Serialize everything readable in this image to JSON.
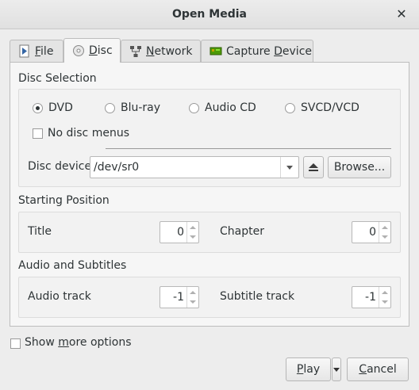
{
  "window": {
    "title": "Open Media",
    "close_glyph": "✕"
  },
  "tabs": [
    {
      "label": "File",
      "accel": "F",
      "rest": "ile",
      "icon": "file-icon"
    },
    {
      "label": "Disc",
      "accel": "D",
      "rest": "isc",
      "icon": "disc-icon",
      "active": true
    },
    {
      "label": "Network",
      "accel": "N",
      "rest": "etwork",
      "icon": "network-icon"
    },
    {
      "label": "Capture Device",
      "pre": "Capture ",
      "accel": "D",
      "rest": "evice",
      "icon": "capture-card-icon"
    }
  ],
  "disc_selection": {
    "title": "Disc Selection",
    "radios": [
      {
        "label": "DVD",
        "checked": true
      },
      {
        "label": "Blu-ray",
        "checked": false
      },
      {
        "label": "Audio CD",
        "checked": false
      },
      {
        "label": "SVCD/VCD",
        "checked": false
      }
    ],
    "no_disc_menus": {
      "label": "No disc menus",
      "checked": false
    },
    "device_label": "Disc device",
    "device_value": "/dev/sr0",
    "browse_label": "Browse..."
  },
  "starting_position": {
    "title": "Starting Position",
    "title_label": "Title",
    "title_value": "0",
    "chapter_label": "Chapter",
    "chapter_value": "0"
  },
  "audio_subtitles": {
    "title": "Audio and Subtitles",
    "audio_label": "Audio track",
    "audio_value": "-1",
    "subtitle_label": "Subtitle track",
    "subtitle_value": "-1"
  },
  "footer": {
    "show_more": {
      "pre": "Show ",
      "accel": "m",
      "rest": "ore options",
      "checked": false
    },
    "play": {
      "accel": "P",
      "rest": "lay"
    },
    "cancel": {
      "accel": "C",
      "rest": "ancel"
    }
  }
}
